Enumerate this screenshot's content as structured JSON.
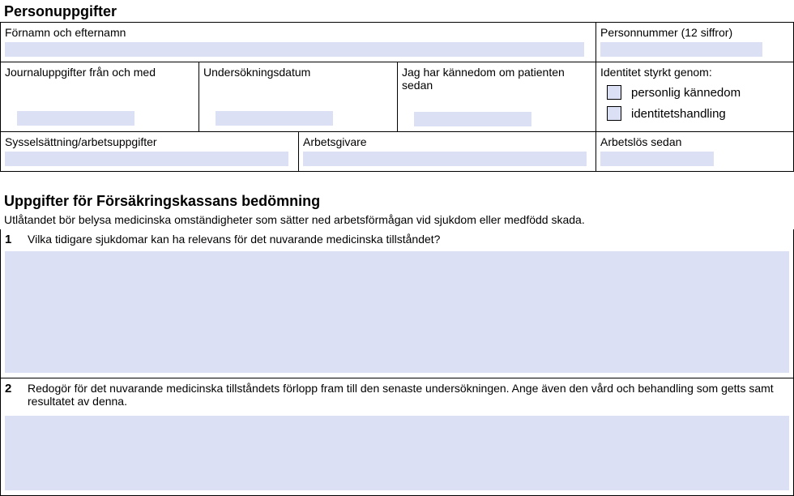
{
  "section1": {
    "title": "Personuppgifter",
    "name_label": "Förnamn och efternamn",
    "name_value": "",
    "pnr_label": "Personnummer (12 siffror)",
    "pnr_value": "",
    "journal_label": "Journaluppgifter från och med",
    "journal_value": "",
    "examdate_label": "Undersökningsdatum",
    "examdate_value": "",
    "known_label": "Jag har kännedom om patienten sedan",
    "known_value": "",
    "identity_label": "Identitet styrkt genom:",
    "identity_opt1": "personlig kännedom",
    "identity_opt2": "identitetshandling",
    "occupation_label": "Sysselsättning/arbetsuppgifter",
    "occupation_value": "",
    "employer_label": "Arbetsgivare",
    "employer_value": "",
    "unemployed_label": "Arbetslös sedan",
    "unemployed_value": ""
  },
  "section2": {
    "title": "Uppgifter för Försäkringskassans bedömning",
    "subtitle": "Utlåtandet bör belysa medicinska omständigheter som sätter ned arbetsförmågan vid sjukdom eller medfödd skada.",
    "q1_num": "1",
    "q1_text": "Vilka tidigare sjukdomar kan ha relevans för det nuvarande medicinska tillståndet?",
    "q1_value": "",
    "q2_num": "2",
    "q2_text": "Redogör för det nuvarande medicinska tillståndets förlopp fram till den senaste undersökningen. Ange även den vård och behandling som getts samt resultatet av denna.",
    "q2_value": ""
  }
}
